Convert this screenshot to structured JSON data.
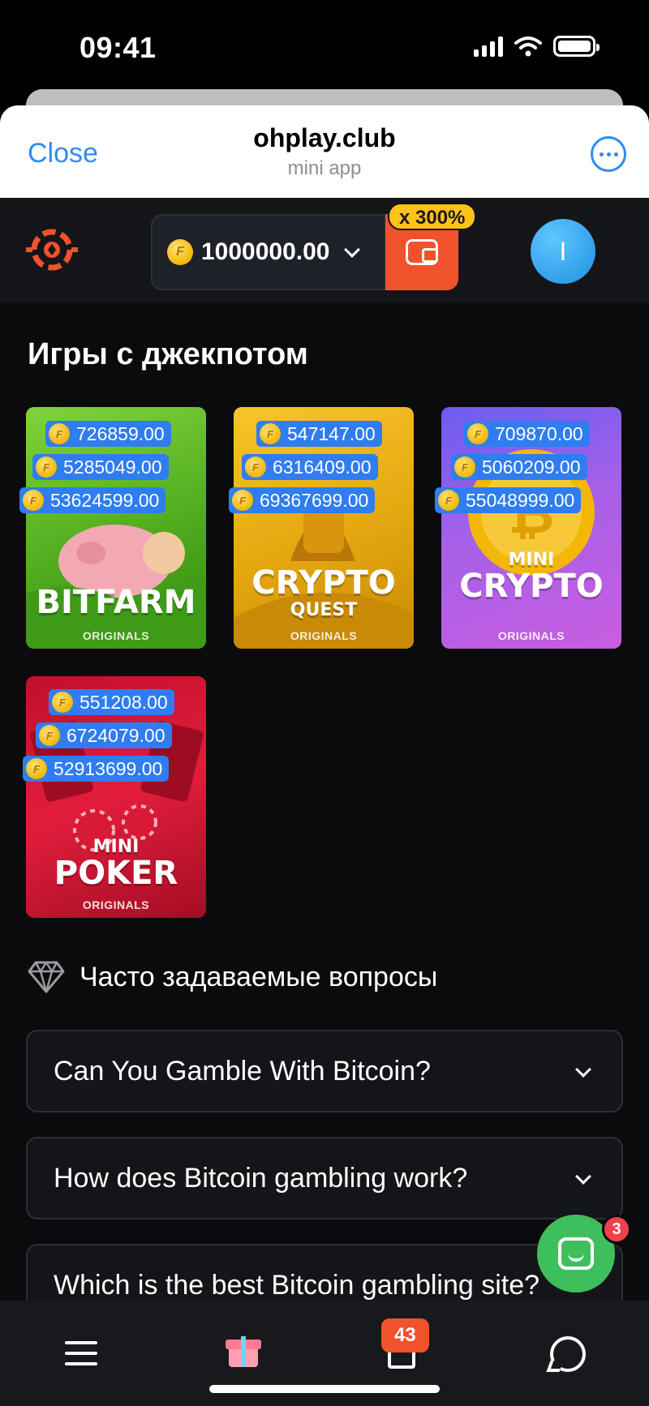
{
  "status_bar": {
    "time": "09:41"
  },
  "mini_app_header": {
    "close_label": "Close",
    "title": "ohplay.club",
    "subtitle": "mini app"
  },
  "top_bar": {
    "balance": "1000000.00",
    "bonus_badge": "x 300%",
    "avatar_initial": "I"
  },
  "jackpot_section": {
    "title": "Игры с джекпотом",
    "games": [
      {
        "name_line1": "BITFARM",
        "name_line2": "",
        "tag": "ORIGINALS",
        "jackpots": [
          "726859.00",
          "5285049.00",
          "53624599.00"
        ]
      },
      {
        "name_line1": "CRYPTO",
        "name_line2": "QUEST",
        "tag": "ORIGINALS",
        "jackpots": [
          "547147.00",
          "6316409.00",
          "69367699.00"
        ]
      },
      {
        "name_line1": "MINI",
        "name_line2": "CRYPTO",
        "tag": "ORIGINALS",
        "jackpots": [
          "709870.00",
          "5060209.00",
          "55048999.00"
        ]
      },
      {
        "name_line1": "MINI",
        "name_line2": "POKER",
        "tag": "ORIGINALS",
        "jackpots": [
          "551208.00",
          "6724079.00",
          "52913699.00"
        ]
      }
    ]
  },
  "faq": {
    "title": "Часто задаваемые вопросы",
    "items": [
      "Can You Gamble With Bitcoin?",
      "How does Bitcoin gambling work?",
      "Which is the best Bitcoin gambling site?"
    ]
  },
  "chat_widget": {
    "badge": "3"
  },
  "bottom_nav": {
    "notifications_count": "43"
  }
}
